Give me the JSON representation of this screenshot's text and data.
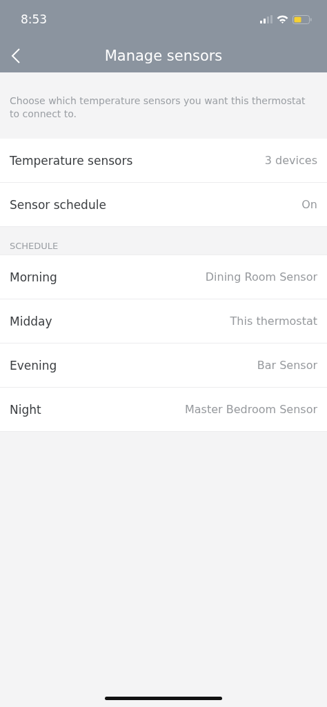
{
  "status_bar": {
    "time": "8:53"
  },
  "nav": {
    "title": "Manage sensors"
  },
  "description": "Choose which temperature sensors you want this thermostat to connect to.",
  "settings": [
    {
      "label": "Temperature sensors",
      "value": "3 devices"
    },
    {
      "label": "Sensor schedule",
      "value": "On"
    }
  ],
  "schedule": {
    "heading": "SCHEDULE",
    "rows": [
      {
        "label": "Morning",
        "value": "Dining Room Sensor"
      },
      {
        "label": "Midday",
        "value": "This thermostat"
      },
      {
        "label": "Evening",
        "value": "Bar Sensor"
      },
      {
        "label": "Night",
        "value": "Master Bedroom Sensor"
      }
    ]
  }
}
